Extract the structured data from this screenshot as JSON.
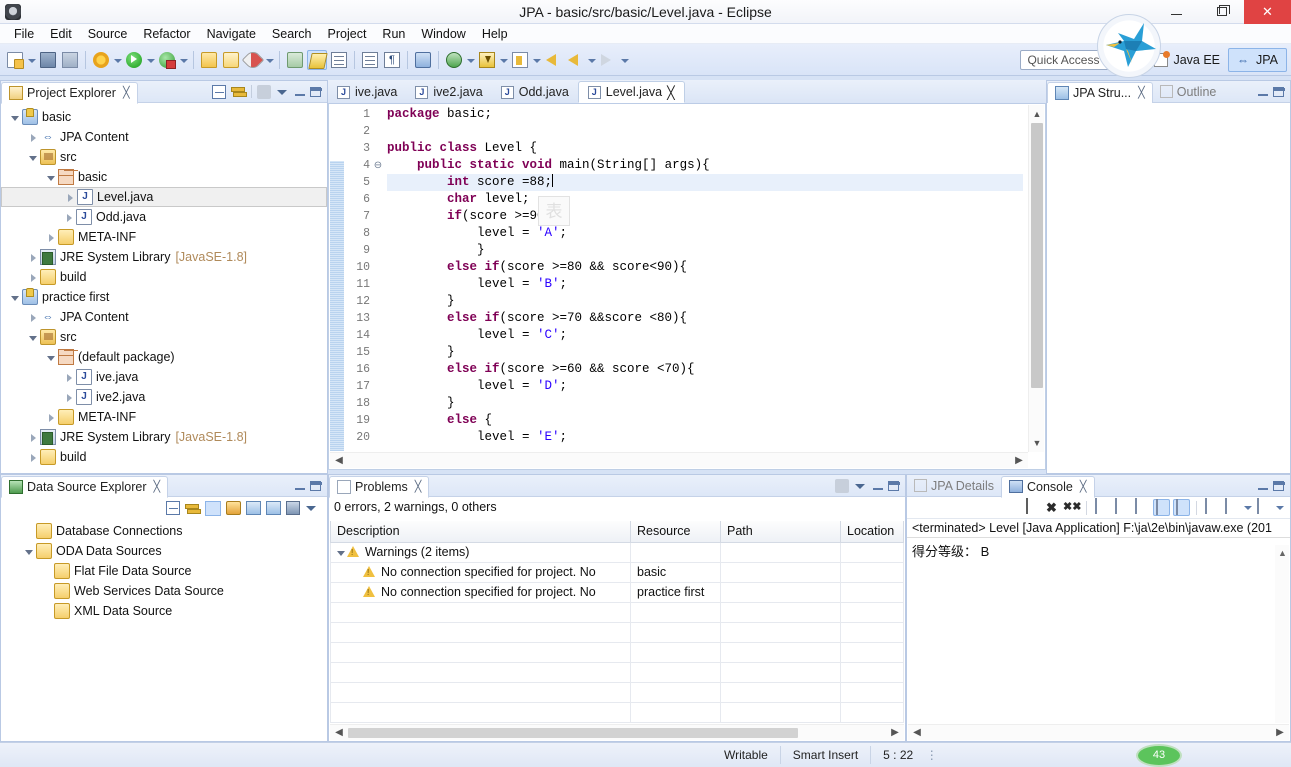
{
  "window": {
    "title": "JPA - basic/src/basic/Level.java - Eclipse",
    "minimize_label": "Minimize",
    "maximize_label": "Maximize",
    "close_label": "Close"
  },
  "menu": {
    "items": [
      "File",
      "Edit",
      "Source",
      "Refactor",
      "Navigate",
      "Search",
      "Project",
      "Run",
      "Window",
      "Help"
    ]
  },
  "toolbar": {
    "quick_access_placeholder": "Quick Access",
    "perspectives": [
      {
        "label": "Java EE",
        "icon": "java-ee-icon",
        "active": false
      },
      {
        "label": "JPA",
        "icon": "jpa-icon",
        "active": true
      }
    ]
  },
  "project_explorer": {
    "tab_label": "Project Explorer",
    "close_label": "╳",
    "tree": [
      {
        "indent": 0,
        "expander": "open",
        "icon": "project-icon",
        "label": "basic"
      },
      {
        "indent": 1,
        "expander": "closed",
        "icon": "jpa-content-icon",
        "label": "JPA Content"
      },
      {
        "indent": 1,
        "expander": "open",
        "icon": "source-folder-icon",
        "label": "src"
      },
      {
        "indent": 2,
        "expander": "open",
        "icon": "package-icon",
        "label": "basic"
      },
      {
        "indent": 3,
        "expander": "closed",
        "icon": "java-file-icon",
        "label": "Level.java",
        "selected": true
      },
      {
        "indent": 3,
        "expander": "closed",
        "icon": "java-file-icon",
        "label": "Odd.java"
      },
      {
        "indent": 2,
        "expander": "closed",
        "icon": "folder-icon",
        "label": "META-INF"
      },
      {
        "indent": 1,
        "expander": "closed",
        "icon": "jre-library-icon",
        "label": "JRE System Library",
        "suffix": "[JavaSE-1.8]"
      },
      {
        "indent": 1,
        "expander": "closed",
        "icon": "folder-icon",
        "label": "build"
      },
      {
        "indent": 0,
        "expander": "open",
        "icon": "project-icon",
        "label": "practice first"
      },
      {
        "indent": 1,
        "expander": "closed",
        "icon": "jpa-content-icon",
        "label": "JPA Content"
      },
      {
        "indent": 1,
        "expander": "open",
        "icon": "source-folder-icon",
        "label": "src"
      },
      {
        "indent": 2,
        "expander": "open",
        "icon": "package-icon",
        "label": "(default package)"
      },
      {
        "indent": 3,
        "expander": "closed",
        "icon": "java-file-icon",
        "label": "ive.java"
      },
      {
        "indent": 3,
        "expander": "closed",
        "icon": "java-file-icon",
        "label": "ive2.java"
      },
      {
        "indent": 2,
        "expander": "closed",
        "icon": "folder-icon",
        "label": "META-INF"
      },
      {
        "indent": 1,
        "expander": "closed",
        "icon": "jre-library-icon",
        "label": "JRE System Library",
        "suffix": "[JavaSE-1.8]"
      },
      {
        "indent": 1,
        "expander": "closed",
        "icon": "folder-icon",
        "label": "build"
      }
    ]
  },
  "data_source_explorer": {
    "tab_label": "Data Source Explorer",
    "close_label": "╳",
    "tree": [
      {
        "indent": 0,
        "expander": "none",
        "icon": "folder-icon",
        "label": "Database Connections"
      },
      {
        "indent": 0,
        "expander": "open",
        "icon": "folder-icon",
        "label": "ODA Data Sources"
      },
      {
        "indent": 1,
        "expander": "none",
        "icon": "folder-icon",
        "label": "Flat File Data Source"
      },
      {
        "indent": 1,
        "expander": "none",
        "icon": "folder-icon",
        "label": "Web Services Data Source"
      },
      {
        "indent": 1,
        "expander": "none",
        "icon": "folder-icon",
        "label": "XML Data Source"
      }
    ]
  },
  "editor": {
    "tabs": [
      {
        "label": "ive.java",
        "active": false
      },
      {
        "label": "ive2.java",
        "active": false
      },
      {
        "label": "Odd.java",
        "active": false
      },
      {
        "label": "Level.java",
        "active": true,
        "close_label": "╳"
      }
    ],
    "watermark": "表",
    "lines": [
      {
        "no": 1,
        "fold": "",
        "segments": [
          {
            "t": "package",
            "c": "kw"
          },
          {
            "t": " basic;",
            "c": ""
          }
        ]
      },
      {
        "no": 2,
        "fold": "",
        "segments": []
      },
      {
        "no": 3,
        "fold": "",
        "segments": [
          {
            "t": "public class",
            "c": "kw"
          },
          {
            "t": " Level {",
            "c": ""
          }
        ]
      },
      {
        "no": 4,
        "fold": "⊖",
        "segments": [
          {
            "t": "    ",
            "c": ""
          },
          {
            "t": "public static void",
            "c": "kw"
          },
          {
            "t": " main(String[] args){",
            "c": ""
          }
        ]
      },
      {
        "no": 5,
        "fold": "",
        "current": true,
        "segments": [
          {
            "t": "        ",
            "c": ""
          },
          {
            "t": "int",
            "c": "kw"
          },
          {
            "t": " score =88;",
            "c": ""
          }
        ]
      },
      {
        "no": 6,
        "fold": "",
        "segments": [
          {
            "t": "        ",
            "c": ""
          },
          {
            "t": "char",
            "c": "kw"
          },
          {
            "t": " level;",
            "c": ""
          }
        ]
      },
      {
        "no": 7,
        "fold": "",
        "segments": [
          {
            "t": "        ",
            "c": ""
          },
          {
            "t": "if",
            "c": "kw"
          },
          {
            "t": "(score >=90){",
            "c": ""
          }
        ]
      },
      {
        "no": 8,
        "fold": "",
        "segments": [
          {
            "t": "            level = ",
            "c": ""
          },
          {
            "t": "'A'",
            "c": "str"
          },
          {
            "t": ";",
            "c": ""
          }
        ]
      },
      {
        "no": 9,
        "fold": "",
        "segments": [
          {
            "t": "            }",
            "c": ""
          }
        ]
      },
      {
        "no": 10,
        "fold": "",
        "segments": [
          {
            "t": "        ",
            "c": ""
          },
          {
            "t": "else if",
            "c": "kw"
          },
          {
            "t": "(score >=80 && score<90){",
            "c": ""
          }
        ]
      },
      {
        "no": 11,
        "fold": "",
        "segments": [
          {
            "t": "            level = ",
            "c": ""
          },
          {
            "t": "'B'",
            "c": "str"
          },
          {
            "t": ";",
            "c": ""
          }
        ]
      },
      {
        "no": 12,
        "fold": "",
        "segments": [
          {
            "t": "        }",
            "c": ""
          }
        ]
      },
      {
        "no": 13,
        "fold": "",
        "segments": [
          {
            "t": "        ",
            "c": ""
          },
          {
            "t": "else if",
            "c": "kw"
          },
          {
            "t": "(score >=70 &&score <80){",
            "c": ""
          }
        ]
      },
      {
        "no": 14,
        "fold": "",
        "segments": [
          {
            "t": "            level = ",
            "c": ""
          },
          {
            "t": "'C'",
            "c": "str"
          },
          {
            "t": ";",
            "c": ""
          }
        ]
      },
      {
        "no": 15,
        "fold": "",
        "segments": [
          {
            "t": "        }",
            "c": ""
          }
        ]
      },
      {
        "no": 16,
        "fold": "",
        "segments": [
          {
            "t": "        ",
            "c": ""
          },
          {
            "t": "else if",
            "c": "kw"
          },
          {
            "t": "(score >=60 && score <70){",
            "c": ""
          }
        ]
      },
      {
        "no": 17,
        "fold": "",
        "segments": [
          {
            "t": "            level = ",
            "c": ""
          },
          {
            "t": "'D'",
            "c": "str"
          },
          {
            "t": ";",
            "c": ""
          }
        ]
      },
      {
        "no": 18,
        "fold": "",
        "segments": [
          {
            "t": "        }",
            "c": ""
          }
        ]
      },
      {
        "no": 19,
        "fold": "",
        "segments": [
          {
            "t": "        ",
            "c": ""
          },
          {
            "t": "else",
            "c": "kw"
          },
          {
            "t": " {",
            "c": ""
          }
        ]
      },
      {
        "no": 20,
        "fold": "",
        "segments": [
          {
            "t": "            level = ",
            "c": ""
          },
          {
            "t": "'E'",
            "c": "str"
          },
          {
            "t": ";",
            "c": ""
          }
        ]
      }
    ]
  },
  "outline_panel": {
    "tabs": [
      {
        "label": "JPA Stru...",
        "active": true,
        "close_label": "╳"
      },
      {
        "label": "Outline",
        "active": false
      }
    ]
  },
  "problems": {
    "tab_label": "Problems",
    "close_label": "╳",
    "summary": "0 errors, 2 warnings, 0 others",
    "columns": [
      "Description",
      "Resource",
      "Path",
      "Location"
    ],
    "rows": [
      {
        "type": "group",
        "description": "Warnings (2 items)",
        "resource": "",
        "path": "",
        "location": ""
      },
      {
        "type": "item",
        "description": "No connection specified for project. No",
        "resource": "basic",
        "path": "",
        "location": ""
      },
      {
        "type": "item",
        "description": "No connection specified for project. No",
        "resource": "practice first",
        "path": "",
        "location": ""
      }
    ]
  },
  "console": {
    "tabs": [
      {
        "label": "JPA Details",
        "active": false
      },
      {
        "label": "Console",
        "active": true,
        "close_label": "╳"
      }
    ],
    "header": "<terminated> Level [Java Application] F:\\ja\\2e\\bin\\javaw.exe (201",
    "output": "得分等级： B"
  },
  "status_bar": {
    "writable": "Writable",
    "insert_mode": "Smart Insert",
    "position": "5 : 22",
    "heap": "43"
  }
}
